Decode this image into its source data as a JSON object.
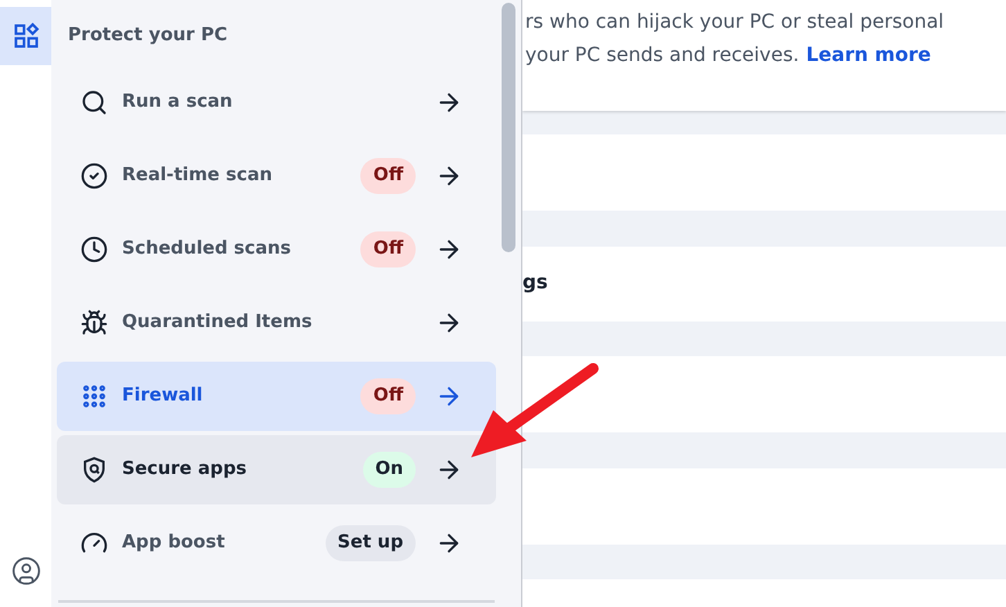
{
  "menu": {
    "heading": "Protect your PC",
    "items": [
      {
        "label": "Run a scan",
        "selected": false,
        "highlighted": false
      },
      {
        "label": "Real-time scan",
        "selected": false,
        "highlighted": false,
        "badge": {
          "text": "Off",
          "kind": "off"
        }
      },
      {
        "label": "Scheduled scans",
        "selected": false,
        "highlighted": false,
        "badge": {
          "text": "Off",
          "kind": "off"
        }
      },
      {
        "label": "Quarantined Items",
        "selected": false,
        "highlighted": false
      },
      {
        "label": "Firewall",
        "selected": true,
        "highlighted": false,
        "badge": {
          "text": "Off",
          "kind": "off"
        }
      },
      {
        "label": "Secure apps",
        "selected": false,
        "highlighted": true,
        "badge": {
          "text": "On",
          "kind": "on"
        }
      },
      {
        "label": "App boost",
        "selected": false,
        "highlighted": false,
        "badge": {
          "text": "Set up",
          "kind": "setup"
        }
      }
    ]
  },
  "content": {
    "lines": [
      "rs who can hijack your PC or steal personal",
      "your PC sends and receives."
    ],
    "link": "Learn more",
    "section_label": "gs"
  }
}
